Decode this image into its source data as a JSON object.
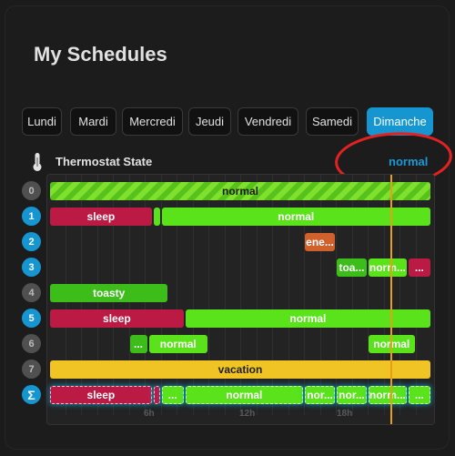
{
  "title": "My Schedules",
  "tabs": [
    {
      "label": "Lundi"
    },
    {
      "label": "Mardi"
    },
    {
      "label": "Mercredi"
    },
    {
      "label": "Jeudi"
    },
    {
      "label": "Vendredi"
    },
    {
      "label": "Samedi"
    },
    {
      "label": "Dimanche",
      "active": true
    }
  ],
  "section": {
    "icon": "thermometer-icon",
    "title": "Thermostat State",
    "value": "normal"
  },
  "hour_labels": [
    "6h",
    "12h",
    "18h"
  ],
  "colors": {
    "normal": "#5ae21a",
    "normal_dark": "#3cbd1a",
    "sleep": "#bb1a44",
    "energy": "#d0612c",
    "vacation": "#f0c424",
    "accent": "#1596d0",
    "now_line": "#e79f14",
    "annotation": "#e22222"
  },
  "rows": [
    {
      "num": "0",
      "active": false,
      "bars": [
        {
          "label": "normal",
          "start": 0,
          "end": 24,
          "color": "normal",
          "hatched": true
        }
      ]
    },
    {
      "num": "1",
      "active": true,
      "bars": [
        {
          "label": "sleep",
          "start": 0,
          "end": 6.5,
          "color": "sleep"
        },
        {
          "label": "",
          "start": 6.5,
          "end": 7,
          "color": "normal"
        },
        {
          "label": "normal",
          "start": 7,
          "end": 24,
          "color": "normal"
        }
      ]
    },
    {
      "num": "2",
      "active": true,
      "bars": [
        {
          "label": "ene...",
          "start": 16,
          "end": 18,
          "color": "energy"
        }
      ]
    },
    {
      "num": "3",
      "active": true,
      "bars": [
        {
          "label": "toa...",
          "start": 18,
          "end": 20,
          "color": "normal_dark"
        },
        {
          "label": "norm...",
          "start": 20,
          "end": 22.5,
          "color": "normal"
        },
        {
          "label": "...",
          "start": 22.5,
          "end": 24,
          "color": "sleep"
        }
      ]
    },
    {
      "num": "4",
      "active": false,
      "bars": [
        {
          "label": "toasty",
          "start": 0,
          "end": 7.5,
          "color": "normal_dark"
        }
      ]
    },
    {
      "num": "5",
      "active": true,
      "bars": [
        {
          "label": "sleep",
          "start": 0,
          "end": 8.5,
          "color": "sleep"
        },
        {
          "label": "normal",
          "start": 8.5,
          "end": 24,
          "color": "normal"
        }
      ]
    },
    {
      "num": "6",
      "active": false,
      "bars": [
        {
          "label": "...",
          "start": 5,
          "end": 6.2,
          "color": "normal_dark"
        },
        {
          "label": "normal",
          "start": 6.2,
          "end": 10,
          "color": "normal"
        },
        {
          "label": "normal",
          "start": 20,
          "end": 23,
          "color": "normal"
        }
      ]
    },
    {
      "num": "7",
      "active": false,
      "bars": [
        {
          "label": "vacation",
          "start": 0,
          "end": 24,
          "color": "vacation"
        }
      ]
    },
    {
      "num": "Σ",
      "active": true,
      "sum": true,
      "bars": [
        {
          "label": "sleep",
          "start": 0,
          "end": 6.5,
          "color": "sleep"
        },
        {
          "label": "",
          "start": 6.5,
          "end": 7,
          "color": "sleep"
        },
        {
          "label": "...",
          "start": 7,
          "end": 8.5,
          "color": "normal"
        },
        {
          "label": "normal",
          "start": 8.5,
          "end": 16,
          "color": "normal"
        },
        {
          "label": "nor...",
          "start": 16,
          "end": 18,
          "color": "normal"
        },
        {
          "label": "nor...",
          "start": 18,
          "end": 20,
          "color": "normal"
        },
        {
          "label": "norm...",
          "start": 20,
          "end": 22.5,
          "color": "normal"
        },
        {
          "label": "...",
          "start": 22.5,
          "end": 24,
          "color": "normal"
        }
      ]
    }
  ],
  "current_time_hours": 21.4
}
